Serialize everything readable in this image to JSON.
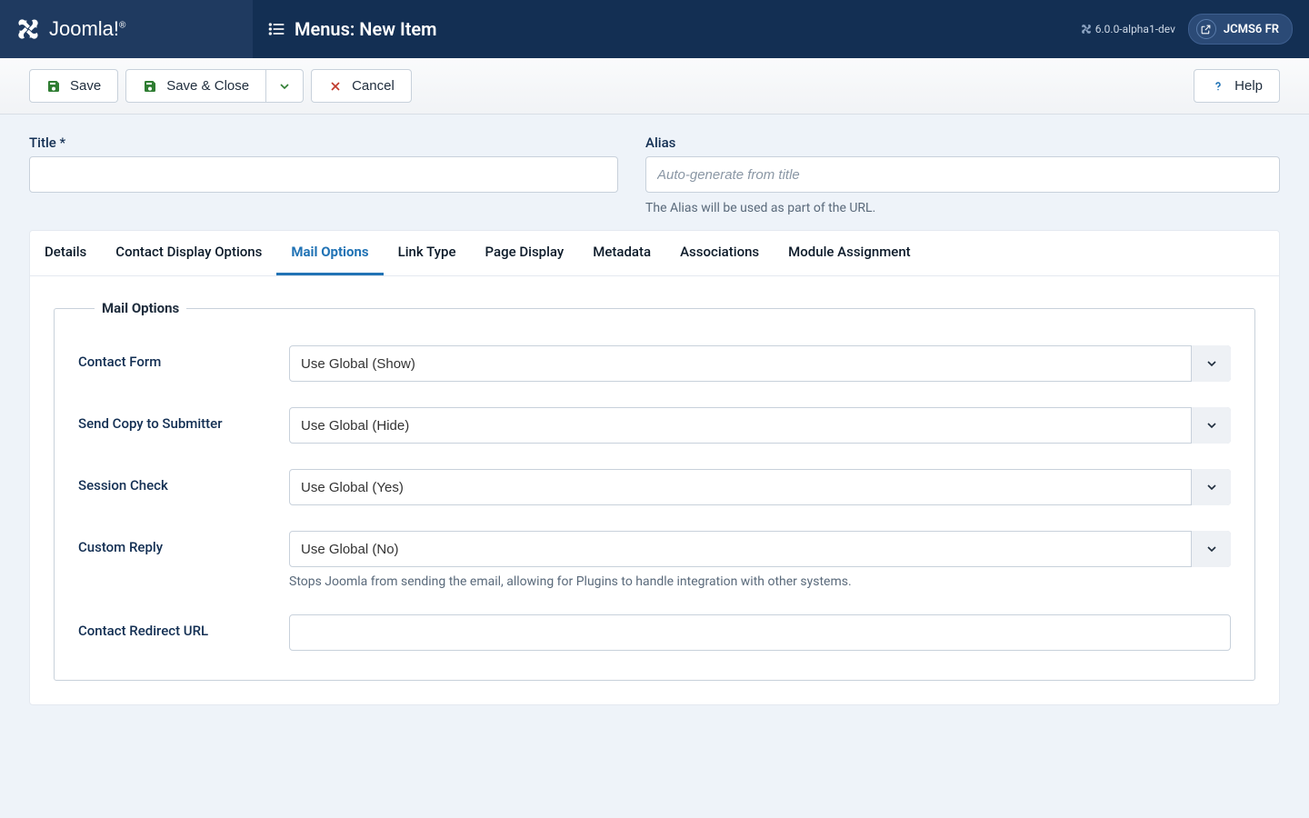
{
  "header": {
    "logo_text": "Joomla!",
    "page_title": "Menus: New Item",
    "version": "6.0.0-alpha1-dev",
    "site_name": "JCMS6 FR"
  },
  "toolbar": {
    "save_label": "Save",
    "save_close_label": "Save & Close",
    "cancel_label": "Cancel",
    "help_label": "Help"
  },
  "head_fields": {
    "title_label": "Title *",
    "title_value": "",
    "alias_label": "Alias",
    "alias_placeholder": "Auto-generate from title",
    "alias_value": "",
    "alias_hint": "The Alias will be used as part of the URL."
  },
  "tabs": [
    {
      "label": "Details",
      "active": false
    },
    {
      "label": "Contact Display Options",
      "active": false
    },
    {
      "label": "Mail Options",
      "active": true
    },
    {
      "label": "Link Type",
      "active": false
    },
    {
      "label": "Page Display",
      "active": false
    },
    {
      "label": "Metadata",
      "active": false
    },
    {
      "label": "Associations",
      "active": false
    },
    {
      "label": "Module Assignment",
      "active": false
    }
  ],
  "fieldset": {
    "legend": "Mail Options",
    "rows": [
      {
        "label": "Contact Form",
        "value": "Use Global (Show)",
        "type": "select",
        "desc": ""
      },
      {
        "label": "Send Copy to Submitter",
        "value": "Use Global (Hide)",
        "type": "select",
        "desc": ""
      },
      {
        "label": "Session Check",
        "value": "Use Global (Yes)",
        "type": "select",
        "desc": ""
      },
      {
        "label": "Custom Reply",
        "value": "Use Global (No)",
        "type": "select",
        "desc": "Stops Joomla from sending the email, allowing for Plugins to handle integration with other systems."
      },
      {
        "label": "Contact Redirect URL",
        "value": "",
        "type": "text",
        "desc": ""
      }
    ]
  }
}
